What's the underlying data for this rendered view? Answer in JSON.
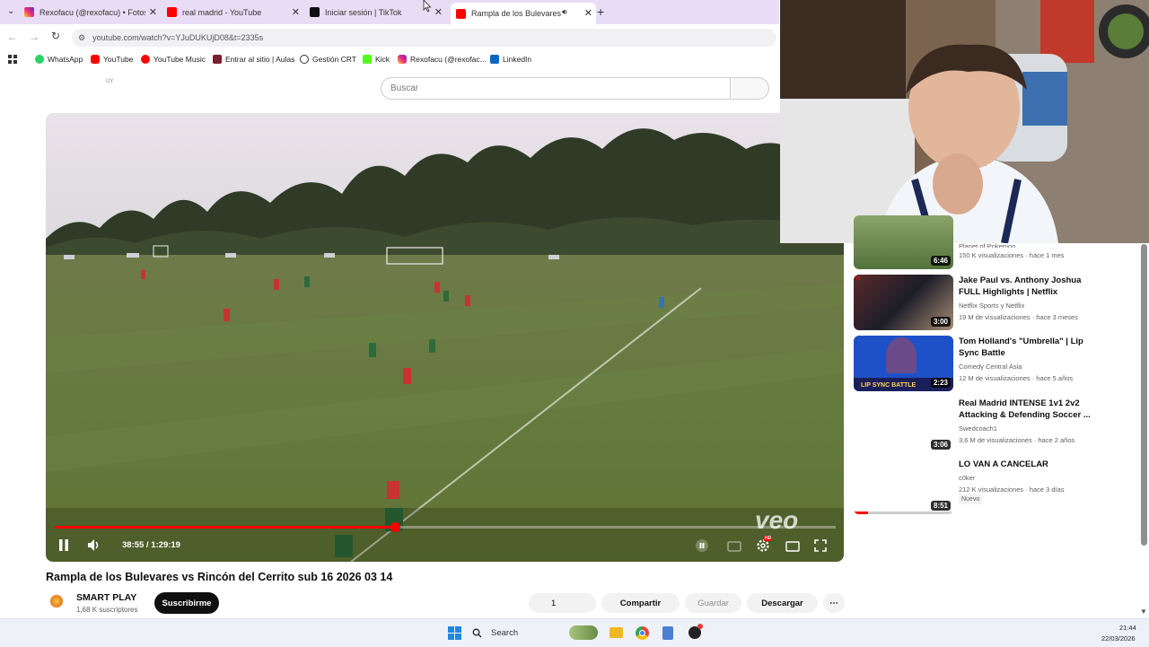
{
  "browser": {
    "tabs": [
      {
        "label": "Rexofacu (@rexofacu) • Fotos y",
        "icon": "instagram-icon",
        "color": "#d6249f"
      },
      {
        "label": "real madrid - YouTube",
        "icon": "youtube-icon",
        "color": "#ff0000"
      },
      {
        "label": "Iniciar sesión | TikTok",
        "icon": "tiktok-icon",
        "color": "#111111"
      },
      {
        "label": "Rampla de los Bulevares vs",
        "icon": "youtube-icon",
        "color": "#ff0000",
        "active": true
      }
    ],
    "url": "youtube.com/watch?v=YJuDUKUjD08&t=2335s",
    "bookmarks": [
      {
        "label": "WhatsApp",
        "color": "#25d366"
      },
      {
        "label": "YouTube",
        "color": "#ff0000"
      },
      {
        "label": "YouTube Music",
        "color": "#ff0000"
      },
      {
        "label": "Entrar al sitio | Aulas",
        "color": "#7a1f2b"
      },
      {
        "label": "Gestión CRT",
        "color": "#333333"
      },
      {
        "label": "Kick",
        "color": "#53fc18"
      },
      {
        "label": "Rexofacu (@rexofac...",
        "color": "#d6249f"
      },
      {
        "label": "LinkedIn",
        "color": "#0a66c2"
      }
    ]
  },
  "youtube": {
    "logo_text": "UY",
    "search_placeholder": "Buscar"
  },
  "player": {
    "time_display": "38:55 / 1:29:19",
    "progress_fraction": 0.436,
    "watermark": "veo",
    "hd_badge": "HD"
  },
  "video": {
    "title": "Rampla de los Bulevares vs Rincón del Cerrito sub 16 2026 03 14",
    "channel": "SMART PLAY",
    "subscribers": "1,68 K suscriptores",
    "subscribe_label": "Suscribirme",
    "like_count": "1",
    "share_label": "Compartir",
    "save_label": "Guardar",
    "download_label": "Descargar"
  },
  "recommendations": [
    {
      "title": "",
      "channel": "Planet of Pokemon",
      "meta": "150 K visualizaciones · hace 1 mes",
      "duration": "6:46"
    },
    {
      "title": "Jake Paul vs. Anthony Joshua FULL Highlights | Netflix",
      "channel": "Netflix Sports     y Netflix",
      "meta": "19 M de visualizaciones · hace 3 meses",
      "duration": "3:00"
    },
    {
      "title": "Tom Holland's \"Umbrella\" | Lip Sync Battle",
      "channel": "Comedy Central Asia",
      "meta": "12 M de visualizaciones · hace 5 años",
      "duration": "2:23",
      "thumb_text": "LIP SYNC BATTLE"
    },
    {
      "title": "Real Madrid INTENSE 1v1 2v2 Attacking & Defending Soccer ...",
      "channel": "Swedcoach1",
      "meta": "3,6 M de visualizaciones · hace 2 años",
      "duration": "3:06"
    },
    {
      "title": "LO VAN A CANCELAR",
      "channel": "c0ker",
      "meta": "212 K visualizaciones · hace 3 días",
      "duration": "8:51",
      "badge": "Nuevo",
      "watched_fraction": 0.14
    }
  ],
  "taskbar": {
    "search_label": "Search",
    "time": "21:44",
    "date": "22/03/2026"
  }
}
